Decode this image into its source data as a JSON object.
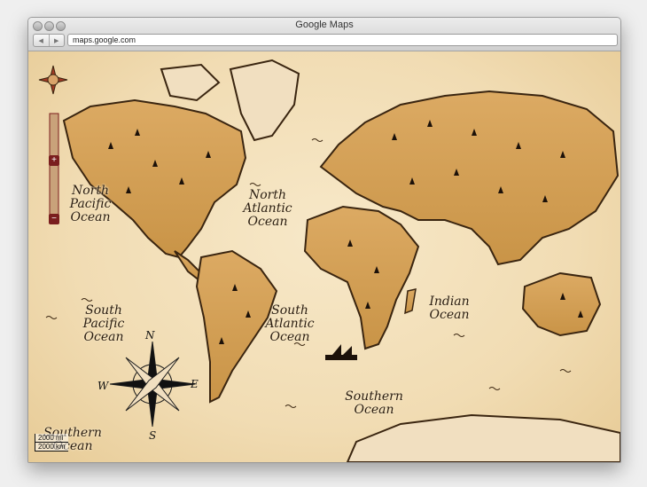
{
  "window": {
    "title": "Google Maps"
  },
  "toolbar": {
    "back_label": "◀",
    "forward_label": "▶",
    "url": "maps.google.com"
  },
  "map": {
    "oceans": [
      {
        "name": "North Pacific Ocean",
        "lines": [
          "North",
          "Pacific",
          "Ocean"
        ]
      },
      {
        "name": "North Atlantic Ocean",
        "lines": [
          "North",
          "Atlantic",
          "Ocean"
        ]
      },
      {
        "name": "South Pacific Ocean",
        "lines": [
          "South",
          "Pacific",
          "Ocean"
        ]
      },
      {
        "name": "South Atlantic Ocean",
        "lines": [
          "South",
          "Atlantic",
          "Ocean"
        ]
      },
      {
        "name": "Indian Ocean",
        "lines": [
          "Indian",
          "Ocean"
        ]
      },
      {
        "name": "Southern Ocean",
        "lines": [
          "Southern",
          "Ocean"
        ]
      },
      {
        "name": "Southern Ocean (left)",
        "lines": [
          "Southern",
          "Ocean"
        ]
      }
    ],
    "compass": {
      "n": "N",
      "s": "S",
      "e": "E",
      "w": "W"
    },
    "scale": {
      "top": "2000 mi",
      "bottom": "2000 km"
    },
    "zoom": {
      "in": "+",
      "out": "−"
    }
  }
}
